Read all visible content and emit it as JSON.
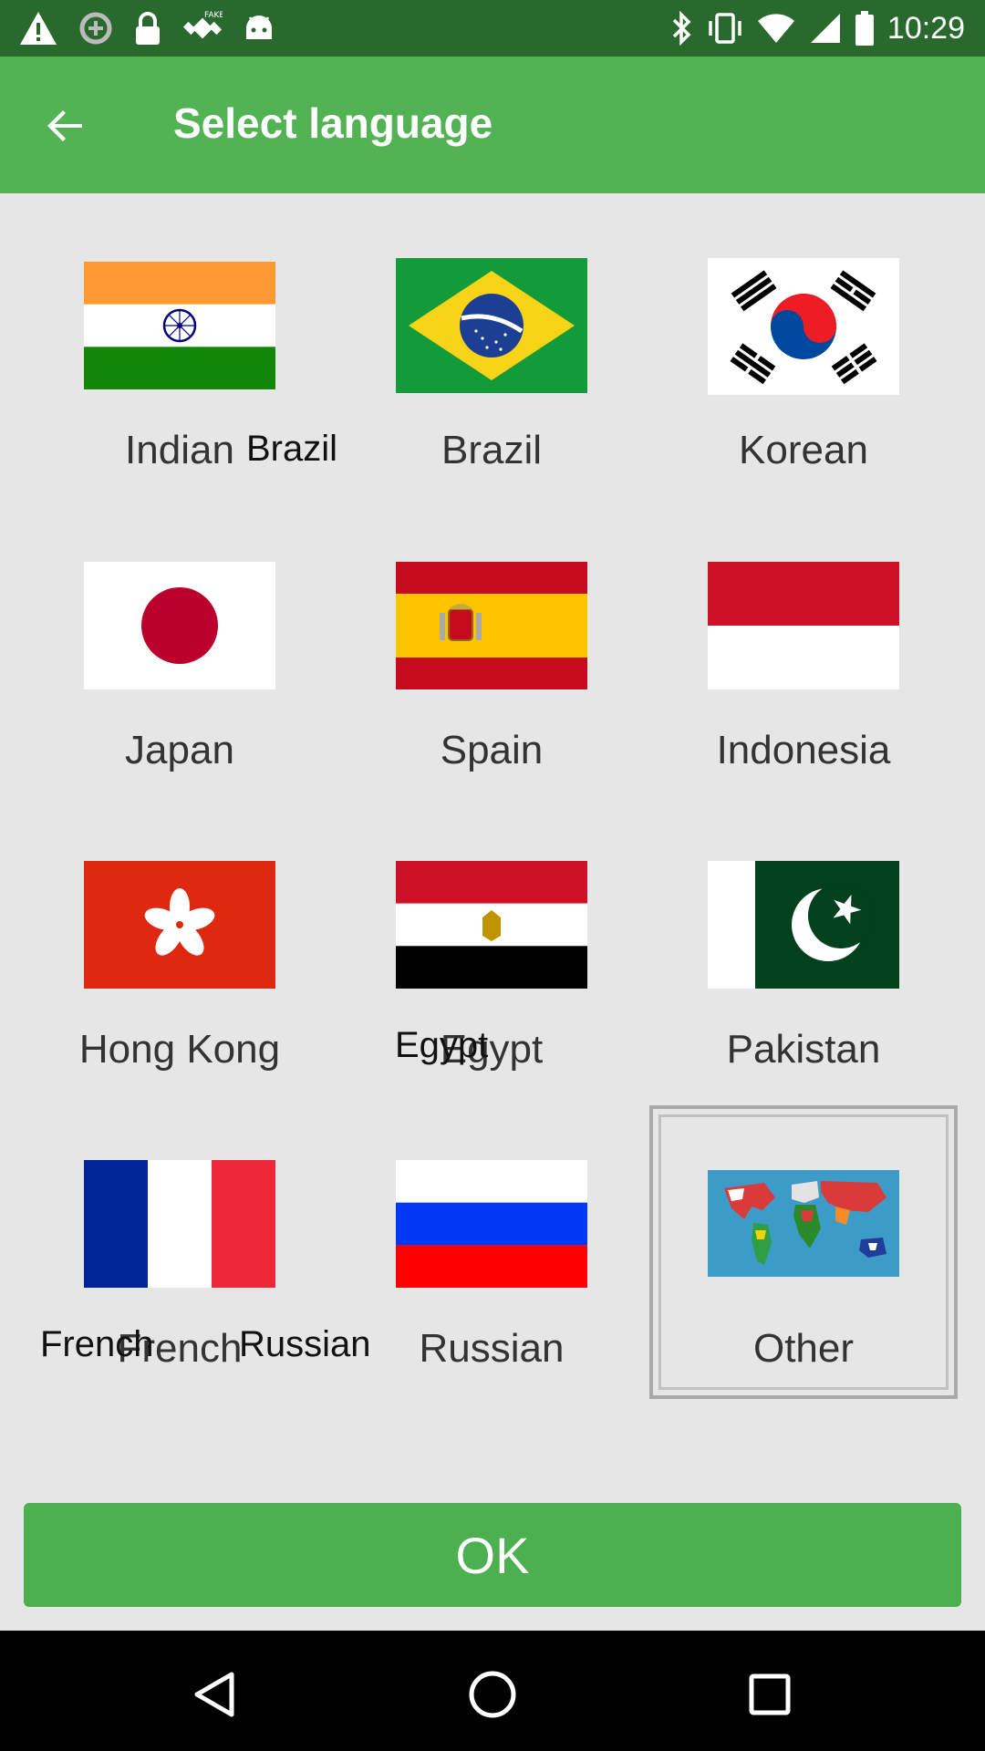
{
  "status_bar": {
    "time": "10:29",
    "left_icons": [
      "warning-icon",
      "data-saver-icon",
      "lock-icon",
      "fake-gps-icon",
      "android-icon"
    ],
    "right_icons": [
      "bluetooth-icon",
      "vibrate-icon",
      "wifi-icon",
      "cellular-signal-icon",
      "battery-icon"
    ]
  },
  "app_bar": {
    "title": "Select language"
  },
  "languages": [
    {
      "label": "Indian",
      "flag": "india-flag-icon"
    },
    {
      "label": "Brazil",
      "flag": "brazil-flag-icon"
    },
    {
      "label": "Korean",
      "flag": "south-korea-flag-icon"
    },
    {
      "label": "Japan",
      "flag": "japan-flag-icon"
    },
    {
      "label": "Spain",
      "flag": "spain-flag-icon"
    },
    {
      "label": "Indonesia",
      "flag": "indonesia-flag-icon"
    },
    {
      "label": "Hong Kong",
      "flag": "hong-kong-flag-icon"
    },
    {
      "label": "Egypt",
      "flag": "egypt-flag-icon"
    },
    {
      "label": "Pakistan",
      "flag": "pakistan-flag-icon"
    },
    {
      "label": "French",
      "flag": "france-flag-icon"
    },
    {
      "label": "Russian",
      "flag": "russia-flag-icon"
    },
    {
      "label": "Other",
      "flag": "world-map-flags-icon",
      "selected": true
    }
  ],
  "overlay_labels": {
    "brazil": "Brazil",
    "egypt": "Egypt",
    "french": "French",
    "russian": "Russian"
  },
  "ok_button": {
    "label": "OK"
  },
  "colors": {
    "status_bar": "#2a692e",
    "app_bar": "#52b254",
    "ok_button": "#4caf50",
    "background": "#e6e6e6"
  }
}
